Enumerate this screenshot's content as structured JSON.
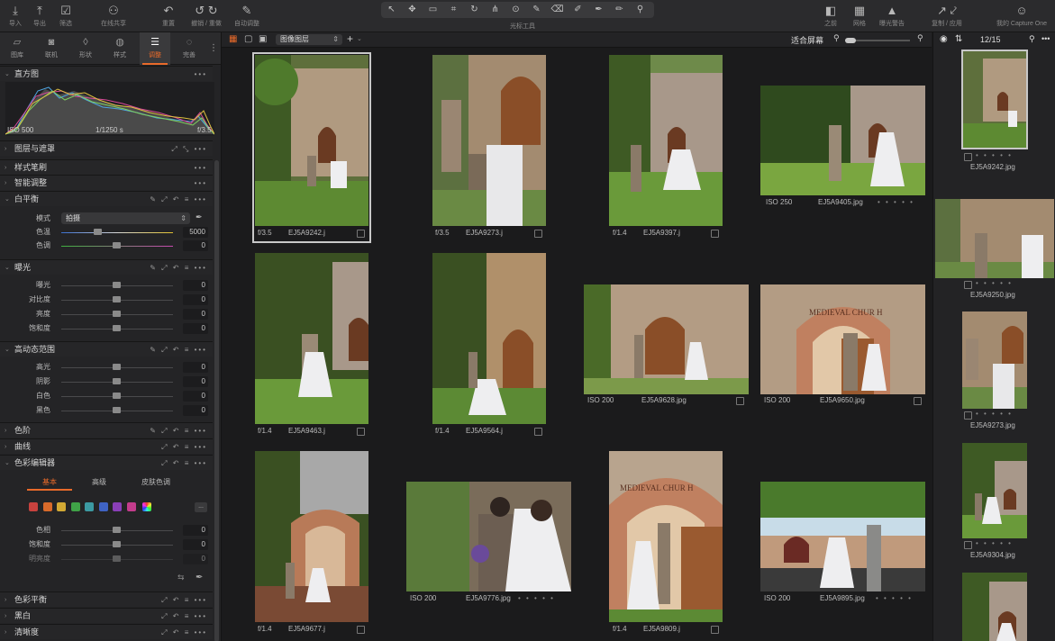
{
  "toolbar": {
    "left": [
      {
        "label": "导入",
        "icon": "import-icon"
      },
      {
        "label": "导出",
        "icon": "export-icon"
      },
      {
        "label": "筛选",
        "icon": "filter-icon"
      },
      {
        "label": "在线共享",
        "icon": "share-icon"
      },
      {
        "label": "重置",
        "icon": "reset-icon"
      },
      {
        "label": "撤销 / 重做",
        "icon": "undo-icon"
      },
      {
        "label": "自动调整",
        "icon": "auto-adjust-icon"
      }
    ],
    "cursor_tools_label": "光标工具",
    "right": [
      {
        "label": "之前",
        "icon": "before-icon"
      },
      {
        "label": "网格",
        "icon": "grid-icon"
      },
      {
        "label": "曝光警告",
        "icon": "exposure-warning-icon"
      },
      {
        "label": "复制 / 应用",
        "icon": "copy-apply-icon"
      },
      {
        "label": "我的 Capture One",
        "icon": "account-icon"
      }
    ]
  },
  "tool_tabs": [
    {
      "label": "图库"
    },
    {
      "label": "联机"
    },
    {
      "label": "形状"
    },
    {
      "label": "样式"
    },
    {
      "label": "调整",
      "active": true
    },
    {
      "label": "完善"
    }
  ],
  "histogram": {
    "title": "直方图",
    "iso": "ISO 500",
    "shutter": "1/1250 s",
    "aperture": "f/3.5"
  },
  "sections": {
    "layers": "图层与遮罩",
    "style_brush": "样式笔刷",
    "smart_adjust": "智能调整",
    "white_balance": {
      "title": "白平衡",
      "mode_label": "模式",
      "mode_value": "拍摄",
      "temp_label": "色温",
      "temp_value": "5000",
      "tint_label": "色调",
      "tint_value": "0"
    },
    "exposure": {
      "title": "曝光",
      "rows": [
        {
          "label": "曝光",
          "value": "0"
        },
        {
          "label": "对比度",
          "value": "0"
        },
        {
          "label": "亮度",
          "value": "0"
        },
        {
          "label": "饱和度",
          "value": "0"
        }
      ]
    },
    "hdr": {
      "title": "高动态范围",
      "rows": [
        {
          "label": "高光",
          "value": "0"
        },
        {
          "label": "阴影",
          "value": "0"
        },
        {
          "label": "白色",
          "value": "0"
        },
        {
          "label": "黑色",
          "value": "0"
        }
      ]
    },
    "levels": "色阶",
    "curves": "曲线",
    "color_editor": {
      "title": "色彩编辑器",
      "tabs": [
        "基本",
        "高级",
        "皮肤色调"
      ],
      "swatches": [
        "#c8423e",
        "#d86a2a",
        "#d2a934",
        "#3fa247",
        "#3c9aa2",
        "#3f63c4",
        "#8a3fb8",
        "#c33c8c"
      ],
      "rows": [
        {
          "label": "色相",
          "value": "0"
        },
        {
          "label": "饱和度",
          "value": "0"
        },
        {
          "label": "明亮度",
          "value": "0"
        }
      ]
    },
    "color_balance": "色彩平衡",
    "bw": "黑白",
    "clarity": "清晰度"
  },
  "browser": {
    "view_select": "图像图层",
    "fit_label": "适合屏幕",
    "counter": "12/15"
  },
  "thumbs": [
    {
      "a": "f/3.5",
      "n": "EJ5A9242.j"
    },
    {
      "a": "f/3.5",
      "n": "EJ5A9273.j"
    },
    {
      "a": "f/1.4",
      "n": "EJ5A9397.j"
    },
    {
      "a": "ISO 250",
      "n": "EJ5A9405.jpg",
      "dots": "• • • • •"
    },
    {
      "a": "f/1.4",
      "n": "EJ5A9463.j"
    },
    {
      "a": "f/1.4",
      "n": "EJ5A9564.j"
    },
    {
      "a": "ISO 200",
      "n": "EJ5A9628.jpg",
      "dots": "• • • • •"
    },
    {
      "a": "ISO 200",
      "n": "EJ5A9650.jpg",
      "dots": "• • • • •"
    },
    {
      "a": "f/1.4",
      "n": "EJ5A9677.j"
    },
    {
      "a": "ISO 200",
      "n": "EJ5A9776.jpg",
      "dots": "• • • • •"
    },
    {
      "a": "f/1.4",
      "n": "EJ5A9809.j"
    },
    {
      "a": "ISO 200",
      "n": "EJ5A9895.jpg",
      "dots": "• • • • •"
    }
  ],
  "filmstrip": [
    {
      "n": "EJ5A9242.jpg"
    },
    {
      "n": "EJ5A9250.jpg"
    },
    {
      "n": "EJ5A9273.jpg"
    },
    {
      "n": "EJ5A9304.jpg"
    }
  ],
  "dots": "• • • • •",
  "photo_text": {
    "medieval_church": "MEDIEVAL CHUR H"
  }
}
